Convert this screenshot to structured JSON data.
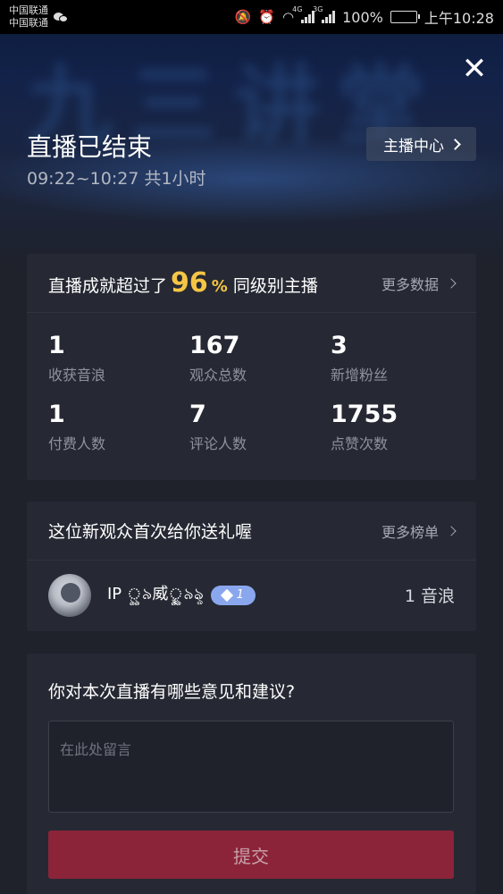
{
  "status_bar": {
    "carrier_1": "中国联通",
    "carrier_2": "中国联通",
    "network_1": "4G",
    "network_2": "3G",
    "battery": "100%",
    "time": "上午10:28"
  },
  "header": {
    "background_text": "九三讲堂",
    "title": "直播已结束",
    "duration": "09:22~10:27 共1小时",
    "anchor_center_label": "主播中心"
  },
  "achievement": {
    "prefix": "直播成就超过了",
    "percent_value": "96",
    "percent_sign": "%",
    "suffix": "同级别主播",
    "more_label": "更多数据",
    "stats": [
      {
        "value": "1",
        "label": "收获音浪"
      },
      {
        "value": "167",
        "label": "观众总数"
      },
      {
        "value": "3",
        "label": "新增粉丝"
      },
      {
        "value": "1",
        "label": "付费人数"
      },
      {
        "value": "7",
        "label": "评论人数"
      },
      {
        "value": "1755",
        "label": "点赞次数"
      }
    ]
  },
  "gift": {
    "title": "这位新观众首次给你送礼喔",
    "more_label": "更多榜单",
    "user_name": "IP ৣ৯威ৄৣ৯ৡ",
    "user_level": "1",
    "amount": "1 音浪"
  },
  "feedback": {
    "title": "你对本次直播有哪些意见和建议?",
    "placeholder": "在此处留言",
    "value": "",
    "submit_label": "提交"
  },
  "colors": {
    "accent_yellow": "#f5c545",
    "submit_bg": "#8c2439",
    "card_bg": "#262933",
    "page_bg": "#1f222b"
  }
}
